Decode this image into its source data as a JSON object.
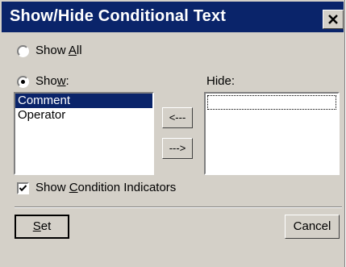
{
  "window": {
    "title": "Show/Hide Conditional Text",
    "close_label": "×"
  },
  "show_all": {
    "prefix": "Show ",
    "accel": "A",
    "suffix": "ll",
    "selected": false
  },
  "show": {
    "prefix": "Sho",
    "accel": "w",
    "suffix": ":",
    "selected": true
  },
  "hide_label": "Hide:",
  "show_list": {
    "items": [
      {
        "label": "Comment",
        "selected": true
      },
      {
        "label": "Operator",
        "selected": false
      }
    ]
  },
  "hide_list": {
    "items": []
  },
  "move_left_label": "<---",
  "move_right_label": "--->",
  "condition_indicators": {
    "prefix": "Show ",
    "accel": "C",
    "suffix": "ondition Indicators",
    "checked": true
  },
  "set_button": {
    "accel": "S",
    "suffix": "et"
  },
  "cancel_label": "Cancel"
}
